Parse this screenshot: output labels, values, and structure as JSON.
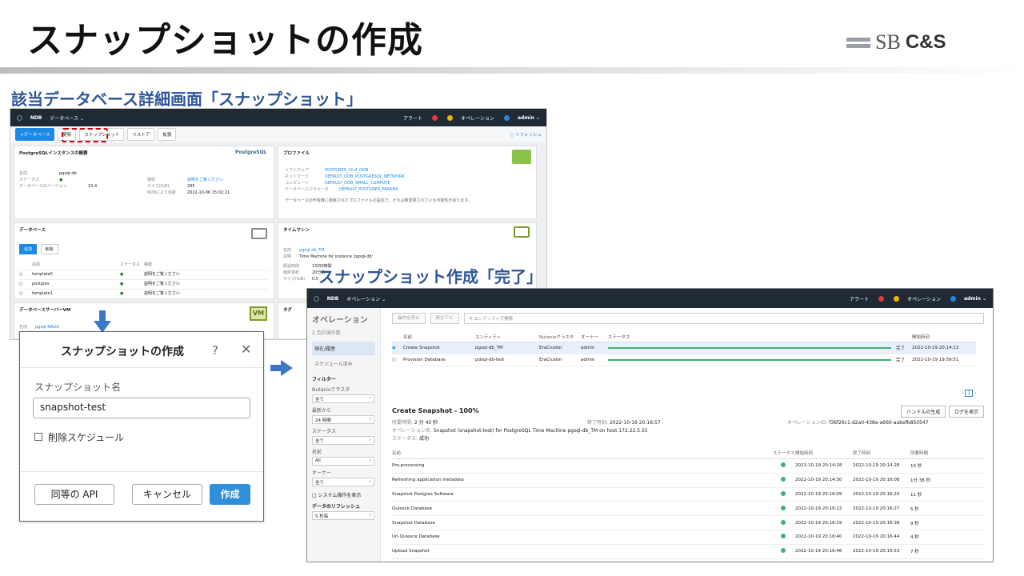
{
  "slide": {
    "title": "スナップショットの作成",
    "logo_sb": "SB",
    "logo_cs": "C&S",
    "heading_left": "該当データベース詳細画面「スナップショット」",
    "heading_right": "スナップショット作成「完了」"
  },
  "shot_a": {
    "topbar": {
      "brand": "NDB",
      "menu": "データベース ⌄",
      "alerts": "アラート",
      "alert_count_red": "0",
      "alert_count_yel": "0",
      "ops": "オペレーション",
      "ops_count": "0",
      "user": "admin ⌄"
    },
    "tabs": [
      "+データベース",
      "更新",
      "スナップショット",
      "リストア",
      "拡張"
    ],
    "refresh": "○ リフレッシュ",
    "summary": {
      "title": "PostgreSQLインスタンスの概要",
      "logo": "PostgreSQL",
      "name_label": "名前",
      "name_value": "pgsql-db",
      "status_label": "ステータス",
      "status_value": "●",
      "version_label": "データベースのバージョン",
      "version_value": "10.4",
      "desc_label": "接続",
      "desc_value": "説明をご覧ください",
      "size_label": "サイズ(GiB)",
      "size_value": "295",
      "created_label": "NDBにより追跡",
      "created_value": "2022-10-06 15:02:21"
    },
    "profile": {
      "title": "プロファイル",
      "sw_label": "ソフトウェア",
      "sw_value": "POSTGRES_10.4_OOB",
      "net_label": "ネットワーク",
      "net_value": "DEFAULT_OOB_POSTGRESQL_NETWORK",
      "compute_label": "コンピュート",
      "compute_value": "DEFAULT_OOB_SMALL_COMPUTE",
      "param_label": "データベースパラメータ",
      "param_value": "DEFAULT_POSTGRES_PARAMS",
      "note": "データベースの作成時に適用されたプロファイルの設定で、それ以降変更されている可能性があります。"
    },
    "databases": {
      "title": "データベース",
      "btn_manage": "追加",
      "btn_delete": "削除",
      "cols": [
        "名前",
        "ステータス",
        "接続"
      ],
      "rows": [
        {
          "name": "template0",
          "desc": "説明をご覧ください"
        },
        {
          "name": "postgres",
          "desc": "説明をご覧ください"
        },
        {
          "name": "template1",
          "desc": "説明をご覧ください"
        }
      ]
    },
    "timemachine": {
      "title": "タイムマシン",
      "name_label": "名前",
      "name_value": "pgsql-db_TM",
      "desc_label": "説明",
      "desc_value": "Time Machine for instance 'pgsql-db'",
      "sla_label": "経過時間",
      "sla_value": "13日5時間",
      "last_label": "最終更新",
      "last_value": "20分前",
      "size_label": "サイズ(GiB)",
      "size_value": "0.5"
    },
    "dbserver": {
      "title": "データベースサーバーVM",
      "name_label": "名前",
      "name_value": "pgsql-NAGA",
      "vm": "VM"
    },
    "tags": {
      "title": "タグ"
    }
  },
  "dialog": {
    "title": "スナップショットの作成",
    "help": "?",
    "close": "✕",
    "name_label": "スナップショット名",
    "name_value": "snapshot-test",
    "delete_schedule": "削除スケジュール",
    "btn_api": "同等の API",
    "btn_cancel": "キャンセル",
    "btn_create": "作成"
  },
  "shot_b": {
    "topbar": {
      "brand": "NDB",
      "menu": "オペレーション ⌄",
      "alerts": "アラート",
      "alert_count_red": "0",
      "alert_count_yel": "0",
      "ops": "オペレーション",
      "ops_count": "0",
      "user": "admin ⌄"
    },
    "sidebar": {
      "title": "オペレーション",
      "count": "2 合計操作数",
      "items": [
        "現在/履歴",
        "スケジュール済み"
      ],
      "filter_title": "フィルター",
      "filters": [
        {
          "label": "Nutanixクラスタ",
          "value": "全て"
        },
        {
          "label": "最新から",
          "value": "24 時間"
        },
        {
          "label": "ステータス",
          "value": "全て"
        },
        {
          "label": "名前",
          "value": "All"
        },
        {
          "label": "オーナー",
          "value": "全て"
        }
      ],
      "system_ops": "システム操作を表示",
      "refresh_label": "データのリフレッシュ",
      "refresh_value": "5 秒毎"
    },
    "toolbar": {
      "btn1": "操作を停止",
      "btn2": "再びアビ",
      "search_placeholder": "エンティティで検索"
    },
    "ops_cols": [
      "名前",
      "エンティティ",
      "Nutanixクラスタ",
      "オーナー",
      "ステータス",
      "開始時刻"
    ],
    "ops": [
      {
        "name": "Create Snapshot",
        "entity": "pgsql-db_TM",
        "cluster": "EraCluster",
        "owner": "admin",
        "status": "完了",
        "start": "2022-10-19 20:14:13",
        "progress": 100
      },
      {
        "name": "Provision Database",
        "entity": "pdsql-db-test",
        "cluster": "EraCluster",
        "owner": "admin",
        "status": "完了",
        "start": "2022-10-19 19:59:51",
        "progress": 100
      }
    ],
    "pager": {
      "page": "1"
    },
    "detail": {
      "title": "Create Snapshot - 100%",
      "btn_bundle": "バンドルの生成",
      "btn_log": "ログを表示",
      "elapsed_label": "所要時間:",
      "elapsed_value": "2 分 40 秒",
      "end_label": "終了時刻:",
      "end_value": "2022-10-19 20:16:57",
      "opid_label": "オペレーションID:",
      "opid_value": "f36f26c1-d2a0-438e-a660-aabefb850547",
      "opname_label": "オペレーション名:",
      "opname_value": "Snapshot (snapshot-test) for PostgreSQL Time Machine pgsql-db_TM on host 172.22.5.55",
      "status_label": "ステータス:",
      "status_value": "成功",
      "step_cols": [
        "名前",
        "ステータス",
        "開始時刻",
        "終了時刻",
        "所要時間"
      ],
      "steps": [
        {
          "name": "Pre-processing",
          "start": "2022-10-19 20:14:18",
          "end": "2022-10-19 20:14:28",
          "dur": "10 秒"
        },
        {
          "name": "Refreshing application metadata",
          "start": "2022-10-19 20:14:30",
          "end": "2022-10-19 20:16:08",
          "dur": "1分 38 秒"
        },
        {
          "name": "Snapshot Postgres Software",
          "start": "2022-10-19 20:16:09",
          "end": "2022-10-19 20:16:20",
          "dur": "11 秒"
        },
        {
          "name": "Quiesce Database",
          "start": "2022-10-19 20:16:22",
          "end": "2022-10-19 20:16:27",
          "dur": "5 秒"
        },
        {
          "name": "Snapshot Database",
          "start": "2022-10-19 20:16:29",
          "end": "2022-10-19 20:16:38",
          "dur": "9 秒"
        },
        {
          "name": "Un-Quiesce Database",
          "start": "2022-10-19 20:16:40",
          "end": "2022-10-19 20:16:44",
          "dur": "4 秒"
        },
        {
          "name": "Upload Snapshot",
          "start": "2022-10-19 20:16:46",
          "end": "2022-10-19 20:16:53",
          "dur": "7 秒"
        }
      ]
    }
  },
  "colors": {
    "accent": "#2f8fd8",
    "heading": "#2f5597",
    "success": "#3cb371",
    "navbar": "#1f2a35",
    "highlight": "#cc0000"
  }
}
